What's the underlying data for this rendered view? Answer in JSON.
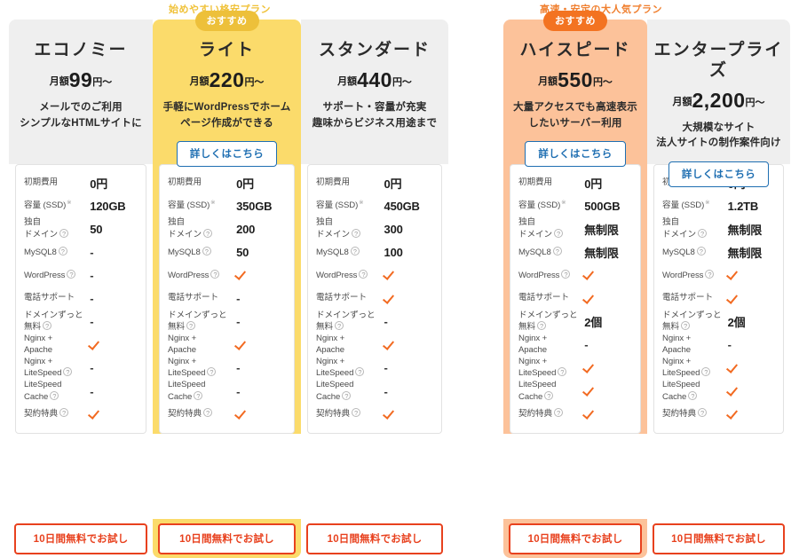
{
  "groups": [
    {
      "banner": "始めやすい格安プラン",
      "banner_color": "#f0c23a",
      "plans": [
        {
          "name": "エコノミー",
          "price_prefix": "月額",
          "price_amount": "99",
          "price_suffix": "円〜",
          "desc_line1": "メールでのご利用",
          "desc_line2": "シンプルなHTMLサイトに",
          "badge": "",
          "detail_label": "",
          "trial_label": "10日間無料でお試し",
          "values": [
            "0円",
            "120GB",
            "50",
            "-",
            "-",
            "-",
            "-",
            "check",
            "-",
            "-",
            "check"
          ]
        },
        {
          "name": "ライト",
          "price_prefix": "月額",
          "price_amount": "220",
          "price_suffix": "円〜",
          "desc_line1": "手軽にWordPressでホーム",
          "desc_line2": "ページ作成ができる",
          "badge": "おすすめ",
          "detail_label": "詳しくはこちら",
          "trial_label": "10日間無料でお試し",
          "values": [
            "0円",
            "350GB",
            "200",
            "50",
            "check",
            "-",
            "-",
            "check",
            "-",
            "-",
            "check"
          ]
        },
        {
          "name": "スタンダード",
          "price_prefix": "月額",
          "price_amount": "440",
          "price_suffix": "円〜",
          "desc_line1": "サポート・容量が充実",
          "desc_line2": "趣味からビジネス用途まで",
          "badge": "",
          "detail_label": "",
          "trial_label": "10日間無料でお試し",
          "values": [
            "0円",
            "450GB",
            "300",
            "100",
            "check",
            "check",
            "-",
            "check",
            "-",
            "-",
            "check"
          ]
        }
      ]
    },
    {
      "banner": "高速・安定の大人気プラン",
      "banner_color": "#f08030",
      "plans": [
        {
          "name": "ハイスピード",
          "price_prefix": "月額",
          "price_amount": "550",
          "price_suffix": "円〜",
          "desc_line1": "大量アクセスでも高速表示",
          "desc_line2": "したいサーバー利用",
          "badge": "おすすめ",
          "detail_label": "詳しくはこちら",
          "trial_label": "10日間無料でお試し",
          "values": [
            "0円",
            "500GB",
            "無制限",
            "無制限",
            "check",
            "check",
            "2個",
            "-",
            "check",
            "check",
            "check"
          ]
        },
        {
          "name": "エンタープライズ",
          "price_prefix": "月額",
          "price_amount": "2,200",
          "price_suffix": "円〜",
          "desc_line1": "大規模なサイト",
          "desc_line2": "法人サイトの制作案件向け",
          "badge": "",
          "detail_label": "詳しくはこちら",
          "trial_label": "10日間無料でお試し",
          "values": [
            "0円",
            "1.2TB",
            "無制限",
            "無制限",
            "check",
            "check",
            "2個",
            "-",
            "check",
            "check",
            "check"
          ]
        }
      ]
    }
  ],
  "spec_rows": [
    {
      "label": "初期費用",
      "hint": false,
      "asterisk": false
    },
    {
      "label": "容量 (SSD)",
      "hint": false,
      "asterisk": true
    },
    {
      "label": "独自\nドメイン",
      "hint": true,
      "asterisk": false
    },
    {
      "label": "MySQL8",
      "hint": true,
      "asterisk": false
    },
    {
      "label": "WordPress",
      "hint": true,
      "asterisk": false
    },
    {
      "label": "電話サポート",
      "hint": false,
      "asterisk": false
    },
    {
      "label": "ドメインずっと\n無料",
      "hint": true,
      "asterisk": false
    },
    {
      "label": "Nginx +\nApache",
      "hint": false,
      "asterisk": false
    },
    {
      "label": "Nginx +\nLiteSpeed",
      "hint": true,
      "asterisk": false
    },
    {
      "label": "LiteSpeed\nCache",
      "hint": true,
      "asterisk": false
    },
    {
      "label": "契約特典",
      "hint": true,
      "asterisk": false
    }
  ],
  "colors": {
    "highlight_yellow": "#fbdb6b",
    "highlight_orange": "#fcc29a",
    "panel_gray": "#efefef",
    "check_orange": "#f26a21",
    "trial_red": "#e8411e",
    "detail_blue": "#1f6fb2",
    "badge_yellow": "#edc03a",
    "badge_orange": "#f37321"
  }
}
